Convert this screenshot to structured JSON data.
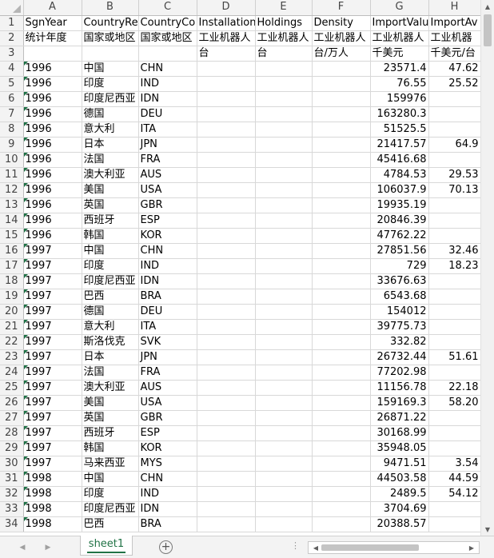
{
  "columns": [
    "A",
    "B",
    "C",
    "D",
    "E",
    "F",
    "G",
    "H"
  ],
  "rows": [
    {
      "n": "1",
      "c": [
        "SgnYear",
        "CountryRe",
        "CountryCo",
        "Installation",
        "Holdings",
        "Density",
        "ImportValu",
        "ImportAv"
      ]
    },
    {
      "n": "2",
      "c": [
        "统计年度",
        "国家或地区",
        "国家或地区",
        "工业机器人",
        "工业机器人",
        "工业机器人",
        "工业机器人",
        "工业机器"
      ]
    },
    {
      "n": "3",
      "c": [
        "",
        "",
        "",
        "台",
        "台",
        "台/万人",
        "千美元",
        "千美元/台"
      ]
    },
    {
      "n": "4",
      "c": [
        "1996",
        "中国",
        "CHN",
        "",
        "",
        "",
        "23571.4",
        "47.62"
      ]
    },
    {
      "n": "5",
      "c": [
        "1996",
        "印度",
        "IND",
        "",
        "",
        "",
        "76.55",
        "25.52"
      ]
    },
    {
      "n": "6",
      "c": [
        "1996",
        "印度尼西亚",
        "IDN",
        "",
        "",
        "",
        "159976",
        ""
      ]
    },
    {
      "n": "7",
      "c": [
        "1996",
        "德国",
        "DEU",
        "",
        "",
        "",
        "163280.3",
        ""
      ]
    },
    {
      "n": "8",
      "c": [
        "1996",
        "意大利",
        "ITA",
        "",
        "",
        "",
        "51525.5",
        ""
      ]
    },
    {
      "n": "9",
      "c": [
        "1996",
        "日本",
        "JPN",
        "",
        "",
        "",
        "21417.57",
        "64.9"
      ]
    },
    {
      "n": "10",
      "c": [
        "1996",
        "法国",
        "FRA",
        "",
        "",
        "",
        "45416.68",
        ""
      ]
    },
    {
      "n": "11",
      "c": [
        "1996",
        "澳大利亚",
        "AUS",
        "",
        "",
        "",
        "4784.53",
        "29.53"
      ]
    },
    {
      "n": "12",
      "c": [
        "1996",
        "美国",
        "USA",
        "",
        "",
        "",
        "106037.9",
        "70.13"
      ]
    },
    {
      "n": "13",
      "c": [
        "1996",
        "英国",
        "GBR",
        "",
        "",
        "",
        "19935.19",
        ""
      ]
    },
    {
      "n": "14",
      "c": [
        "1996",
        "西班牙",
        "ESP",
        "",
        "",
        "",
        "20846.39",
        ""
      ]
    },
    {
      "n": "15",
      "c": [
        "1996",
        "韩国",
        "KOR",
        "",
        "",
        "",
        "47762.22",
        ""
      ]
    },
    {
      "n": "16",
      "c": [
        "1997",
        "中国",
        "CHN",
        "",
        "",
        "",
        "27851.56",
        "32.46"
      ]
    },
    {
      "n": "17",
      "c": [
        "1997",
        "印度",
        "IND",
        "",
        "",
        "",
        "729",
        "18.23"
      ]
    },
    {
      "n": "18",
      "c": [
        "1997",
        "印度尼西亚",
        "IDN",
        "",
        "",
        "",
        "33676.63",
        ""
      ]
    },
    {
      "n": "19",
      "c": [
        "1997",
        "巴西",
        "BRA",
        "",
        "",
        "",
        "6543.68",
        ""
      ]
    },
    {
      "n": "20",
      "c": [
        "1997",
        "德国",
        "DEU",
        "",
        "",
        "",
        "154012",
        ""
      ]
    },
    {
      "n": "21",
      "c": [
        "1997",
        "意大利",
        "ITA",
        "",
        "",
        "",
        "39775.73",
        ""
      ]
    },
    {
      "n": "22",
      "c": [
        "1997",
        "斯洛伐克",
        "SVK",
        "",
        "",
        "",
        "332.82",
        ""
      ]
    },
    {
      "n": "23",
      "c": [
        "1997",
        "日本",
        "JPN",
        "",
        "",
        "",
        "26732.44",
        "51.61"
      ]
    },
    {
      "n": "24",
      "c": [
        "1997",
        "法国",
        "FRA",
        "",
        "",
        "",
        "77202.98",
        ""
      ]
    },
    {
      "n": "25",
      "c": [
        "1997",
        "澳大利亚",
        "AUS",
        "",
        "",
        "",
        "11156.78",
        "22.18"
      ]
    },
    {
      "n": "26",
      "c": [
        "1997",
        "美国",
        "USA",
        "",
        "",
        "",
        "159169.3",
        "58.20"
      ]
    },
    {
      "n": "27",
      "c": [
        "1997",
        "英国",
        "GBR",
        "",
        "",
        "",
        "26871.22",
        ""
      ]
    },
    {
      "n": "28",
      "c": [
        "1997",
        "西班牙",
        "ESP",
        "",
        "",
        "",
        "30168.99",
        ""
      ]
    },
    {
      "n": "29",
      "c": [
        "1997",
        "韩国",
        "KOR",
        "",
        "",
        "",
        "35948.05",
        ""
      ]
    },
    {
      "n": "30",
      "c": [
        "1997",
        "马来西亚",
        "MYS",
        "",
        "",
        "",
        "9471.51",
        "3.54"
      ]
    },
    {
      "n": "31",
      "c": [
        "1998",
        "中国",
        "CHN",
        "",
        "",
        "",
        "44503.58",
        "44.59"
      ]
    },
    {
      "n": "32",
      "c": [
        "1998",
        "印度",
        "IND",
        "",
        "",
        "",
        "2489.5",
        "54.12"
      ]
    },
    {
      "n": "33",
      "c": [
        "1998",
        "印度尼西亚",
        "IDN",
        "",
        "",
        "",
        "3704.69",
        ""
      ]
    },
    {
      "n": "34",
      "c": [
        "1998",
        "巴西",
        "BRA",
        "",
        "",
        "",
        "20388.57",
        ""
      ]
    }
  ],
  "sheet_tab": "sheet1",
  "icons": {
    "scroll_up": "▲",
    "scroll_down": "▼",
    "nav_prev": "◀",
    "nav_next": "▶",
    "add_sheet": "+",
    "more": "⋮",
    "h_left": "◀",
    "h_right": "▶"
  },
  "colors": {
    "accent": "#217346",
    "text_marker": "#1e7145"
  }
}
